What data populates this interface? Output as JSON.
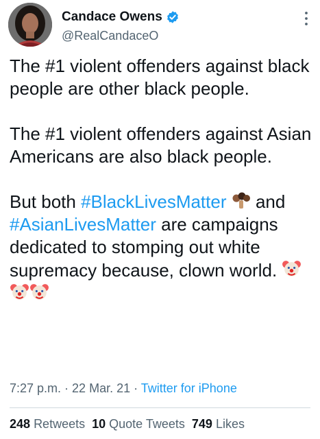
{
  "author": {
    "display_name": "Candace Owens",
    "handle": "@RealCandaceO",
    "verified_icon": "verified-badge-icon",
    "more_icon": "more-vertical-icon"
  },
  "tweet": {
    "para1": "The #1 violent offenders against black people are other black people.",
    "para2": "The #1 violent offenders against Asian Americans are also black people.",
    "para3_part1": "But both ",
    "hashtag1": "#BlackLivesMatter",
    "para3_part2": "and ",
    "hashtag2": "#AsianLivesMatter",
    "para3_part3": " are campaigns dedicated to stomping out white supremacy because, clown world.",
    "emoji_fist": "raised-fists-emoji",
    "emoji_clown": "clown-face-emoji"
  },
  "meta": {
    "time": "7:27 p.m.",
    "separator": " · ",
    "date": "22 Mar. 21",
    "source": "Twitter for iPhone"
  },
  "stats": {
    "retweets_count": "248",
    "retweets_label": "Retweets",
    "quote_count": "10",
    "quote_label": "Quote Tweets",
    "likes_count": "749",
    "likes_label": "Likes"
  },
  "colors": {
    "link": "#1d9bf0",
    "verified": "#1d9bf0",
    "text": "#0f1419",
    "secondary": "#536471"
  }
}
